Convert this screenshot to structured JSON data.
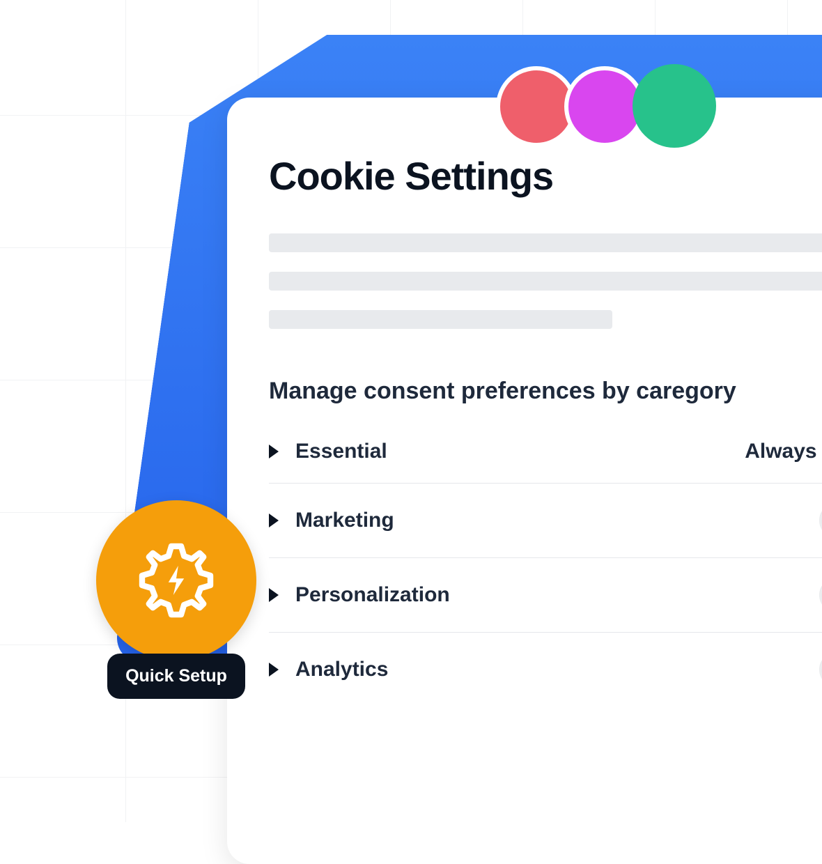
{
  "card": {
    "title": "Cookie Settings",
    "subtitle": "Manage consent preferences by caregory"
  },
  "categories": [
    {
      "label": "Essential",
      "status": "Always active",
      "type": "locked"
    },
    {
      "label": "Marketing",
      "status": "",
      "type": "toggle"
    },
    {
      "label": "Personalization",
      "status": "",
      "type": "toggle"
    },
    {
      "label": "Analytics",
      "status": "",
      "type": "toggle"
    }
  ],
  "badge": {
    "label": "Quick Setup"
  },
  "colors": {
    "circle1": "#EF5F6B",
    "circle2": "#D946EF",
    "circle3": "#27C28B",
    "accent": "#F59E0B",
    "blue": "#3B82F6"
  }
}
